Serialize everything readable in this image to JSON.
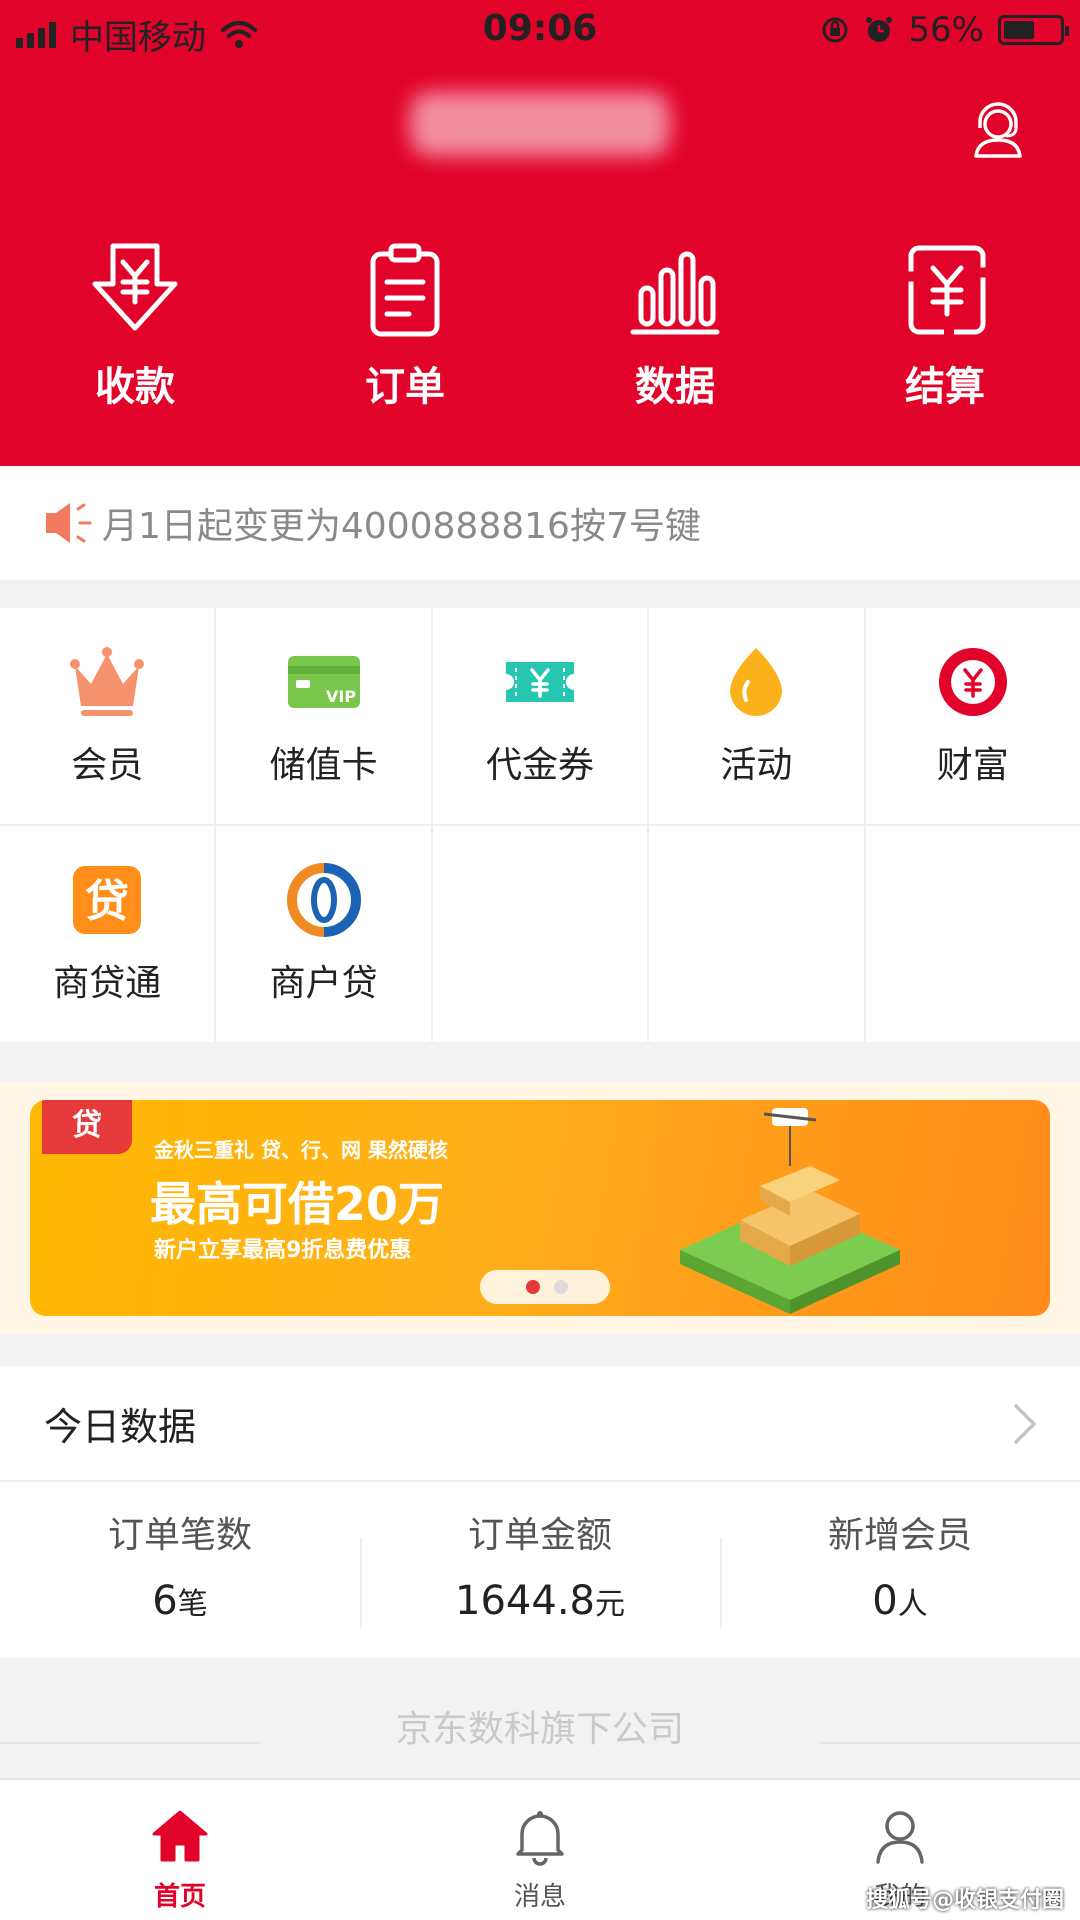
{
  "status_bar": {
    "carrier": "中国移动",
    "time": "09:06",
    "battery": "56%",
    "battery_level": 0.56
  },
  "header": {
    "shop_name": "",
    "quick_actions": [
      {
        "label": "收款",
        "icon": "yen-arrow-down-icon"
      },
      {
        "label": "订单",
        "icon": "clipboard-icon"
      },
      {
        "label": "数据",
        "icon": "bar-chart-icon"
      },
      {
        "label": "结算",
        "icon": "yen-document-icon"
      }
    ],
    "service_icon": "customer-service-icon"
  },
  "notice": {
    "text": "月1日起变更为4000888816按7号键",
    "icon": "speaker-icon"
  },
  "services": [
    {
      "label": "会员",
      "icon": "crown-icon"
    },
    {
      "label": "储值卡",
      "icon": "vip-card-icon"
    },
    {
      "label": "代金券",
      "icon": "coupon-icon"
    },
    {
      "label": "活动",
      "icon": "flame-icon"
    },
    {
      "label": "财富",
      "icon": "yen-coin-icon"
    },
    {
      "label": "商贷通",
      "icon": "loan-badge-icon"
    },
    {
      "label": "商户贷",
      "icon": "ring-logo-icon"
    }
  ],
  "banner": {
    "tag": "贷",
    "line1": "金秋三重礼 贷、行、网 果然硬核",
    "line2": "最高可借20万",
    "line3": "新户立享最高9折息费优惠",
    "active_dot": 0,
    "dot_colors": [
      "#e63a3a",
      "#dcdcdc"
    ]
  },
  "today": {
    "title": "今日数据",
    "stats": [
      {
        "label": "订单笔数",
        "value": "6",
        "unit": "笔"
      },
      {
        "label": "订单金额",
        "value": "1644.8",
        "unit": "元"
      },
      {
        "label": "新增会员",
        "value": "0",
        "unit": "人"
      }
    ]
  },
  "footer": {
    "text": "京东数科旗下公司"
  },
  "tabbar": {
    "items": [
      {
        "label": "首页",
        "icon": "home-icon",
        "active": true
      },
      {
        "label": "消息",
        "icon": "bell-icon",
        "active": false
      },
      {
        "label": "我的",
        "icon": "user-icon",
        "active": false
      }
    ]
  },
  "watermark": "搜狐号@收银支付圈",
  "colors": {
    "brand_red": "#e2032a",
    "banner_orange": "#ffb800"
  }
}
